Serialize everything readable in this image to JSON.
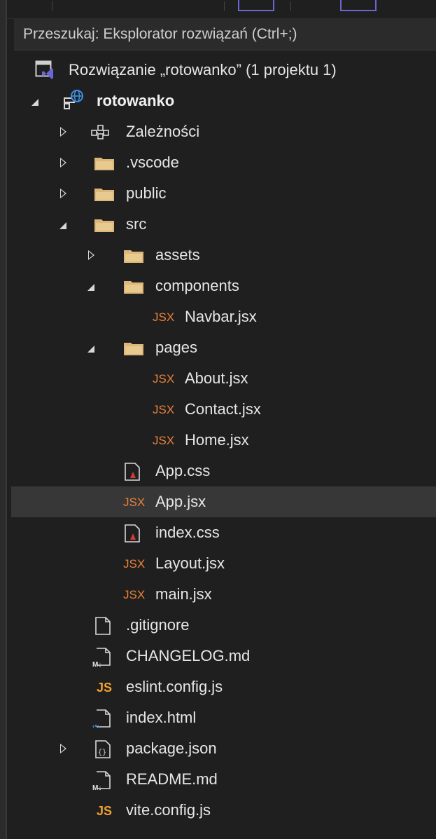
{
  "search": {
    "placeholder": "Przeszukaj: Eksplorator rozwiązań (Ctrl+;)"
  },
  "colors": {
    "background": "#1f1f1f",
    "selected_row": "#373737",
    "folder": "#dcb67a",
    "jsx_tag": "#e8803a",
    "js_tag": "#f0a030",
    "solution_accent": "#6b66d6",
    "project_globe": "#3c8fe0"
  },
  "tree": {
    "solution": {
      "label": "Rozwiązanie „rotowanko” (1 projektu 1)",
      "icon": "solution-icon"
    },
    "project": {
      "label": "rotowanko",
      "icon": "project-web-icon",
      "expanded": true
    },
    "items": [
      {
        "label": "Zależności",
        "icon": "dependencies-icon",
        "expanded": false
      },
      {
        "label": ".vscode",
        "icon": "folder-icon",
        "expanded": false
      },
      {
        "label": "public",
        "icon": "folder-icon",
        "expanded": false
      },
      {
        "label": "src",
        "icon": "folder-icon",
        "expanded": true
      },
      {
        "label": "assets",
        "icon": "folder-icon",
        "expanded": false
      },
      {
        "label": "components",
        "icon": "folder-icon",
        "expanded": true
      },
      {
        "label": "Navbar.jsx",
        "icon": "jsx-file-icon",
        "tag": "JSX"
      },
      {
        "label": "pages",
        "icon": "folder-icon",
        "expanded": true
      },
      {
        "label": "About.jsx",
        "icon": "jsx-file-icon",
        "tag": "JSX"
      },
      {
        "label": "Contact.jsx",
        "icon": "jsx-file-icon",
        "tag": "JSX"
      },
      {
        "label": "Home.jsx",
        "icon": "jsx-file-icon",
        "tag": "JSX"
      },
      {
        "label": "App.css",
        "icon": "css-file-icon"
      },
      {
        "label": "App.jsx",
        "icon": "jsx-file-icon",
        "tag": "JSX",
        "selected": true
      },
      {
        "label": "index.css",
        "icon": "css-file-icon"
      },
      {
        "label": "Layout.jsx",
        "icon": "jsx-file-icon",
        "tag": "JSX"
      },
      {
        "label": "main.jsx",
        "icon": "jsx-file-icon",
        "tag": "JSX"
      },
      {
        "label": ".gitignore",
        "icon": "text-file-icon"
      },
      {
        "label": "CHANGELOG.md",
        "icon": "markdown-file-icon"
      },
      {
        "label": "eslint.config.js",
        "icon": "js-file-icon",
        "tag": "JS"
      },
      {
        "label": "index.html",
        "icon": "html-file-icon"
      },
      {
        "label": "package.json",
        "icon": "json-file-icon",
        "expanded": false
      },
      {
        "label": "README.md",
        "icon": "markdown-file-icon"
      },
      {
        "label": "vite.config.js",
        "icon": "js-file-icon",
        "tag": "JS"
      }
    ]
  }
}
